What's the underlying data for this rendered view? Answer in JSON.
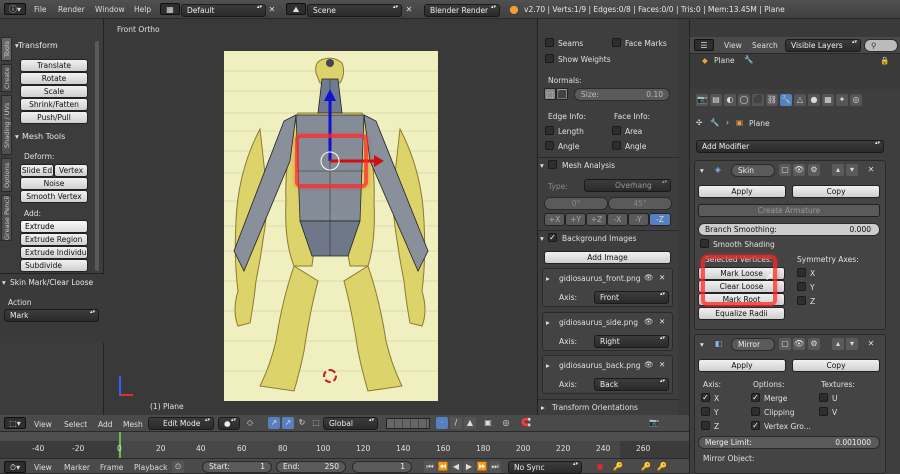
{
  "info_bar": {
    "menus": [
      "File",
      "Render",
      "Window",
      "Help"
    ],
    "layout": "Default",
    "scene": "Scene",
    "engine": "Blender Render",
    "stats": "v2.70 | Verts:1/9 | Edges:0/8 | Faces:0/0 | Tris:0 | Mem:13.45M | Plane"
  },
  "tool_tabs": [
    "Tools",
    "Create",
    "Shading / UVs",
    "Options",
    "Grease Pencil"
  ],
  "tool_shelf": {
    "transform_header": "Transform",
    "transform_buttons": [
      "Translate",
      "Rotate",
      "Scale",
      "Shrink/Fatten",
      "Push/Pull"
    ],
    "mesh_tools_header": "Mesh Tools",
    "deform_label": "Deform:",
    "slide_edge": "Slide Ed",
    "vertex": "Vertex",
    "noise": "Noise",
    "smooth_vertex": "Smooth Vertex",
    "add_label": "Add:",
    "extrude": "Extrude",
    "extrude_region": "Extrude Region",
    "extrude_individual": "Extrude Individual",
    "subdivide": "Subdivide",
    "operator_header": "Skin Mark/Clear Loose",
    "action_label": "Action",
    "action_value": "Mark"
  },
  "viewport": {
    "view_name": "Front Ortho",
    "object_label": "(1) Plane"
  },
  "properties_panel": {
    "seams": "Seams",
    "face_marks": "Face Marks",
    "show_weights": "Show Weights",
    "normals_label": "Normals:",
    "size_field": "Size:",
    "size_value": "0.10",
    "edge_info": "Edge Info:",
    "face_info": "Face Info:",
    "length": "Length",
    "area": "Area",
    "angle1": "Angle",
    "angle2": "Angle",
    "mesh_analysis": "Mesh Analysis",
    "type_label": "Type:",
    "type_value": "Overhang",
    "range_min": "0°",
    "range_max": "45°",
    "axes": [
      "+X",
      "+Y",
      "+Z",
      "-X",
      "-Y",
      "-Z"
    ],
    "background_images": "Background Images",
    "add_image": "Add Image",
    "images": [
      {
        "name": "gidiosaurus_front.png",
        "axis_label": "Axis:",
        "axis": "Front"
      },
      {
        "name": "gidiosaurus_side.png",
        "axis_label": "Axis:",
        "axis": "Right"
      },
      {
        "name": "gidiosaurus_back.png",
        "axis_label": "Axis:",
        "axis": "Back"
      }
    ],
    "transform_orientations": "Transform Orientations"
  },
  "outliner": {
    "menus": [
      "View",
      "Search"
    ],
    "display": "Visible Layers",
    "item": "Plane"
  },
  "modifiers": {
    "breadcrumb": "Plane",
    "add_modifier": "Add Modifier",
    "skin": {
      "name": "Skin",
      "apply": "Apply",
      "copy": "Copy",
      "create_armature": "Create Armature",
      "branch_smoothing_label": "Branch Smoothing:",
      "branch_smoothing_value": "0.000",
      "smooth_shading": "Smooth Shading",
      "selected_vertices": "Selected Vertices:",
      "symmetry_axes": "Symmetry Axes:",
      "mark_loose": "Mark Loose",
      "clear_loose": "Clear Loose",
      "mark_root": "Mark Root",
      "equalize_radii": "Equalize Radii",
      "sym": [
        "X",
        "Y",
        "Z"
      ]
    },
    "mirror": {
      "name": "Mirror",
      "apply": "Apply",
      "copy": "Copy",
      "axis_label": "Axis:",
      "options_label": "Options:",
      "textures_label": "Textures:",
      "axes": [
        "X",
        "Y",
        "Z"
      ],
      "merge": "Merge",
      "clipping": "Clipping",
      "vertex_groups": "Vertex Gro...",
      "tex": [
        "U",
        "V"
      ],
      "merge_limit_label": "Merge Limit:",
      "merge_limit_value": "0.001000",
      "mirror_object": "Mirror Object:"
    }
  },
  "view3d_header": {
    "menus": [
      "View",
      "Select",
      "Add",
      "Mesh"
    ],
    "mode": "Edit Mode",
    "orientation": "Global"
  },
  "timeline": {
    "ticks": [
      "-40",
      "-20",
      "0",
      "20",
      "40",
      "60",
      "80",
      "100",
      "120",
      "140",
      "160",
      "180",
      "200",
      "220",
      "240",
      "260"
    ],
    "menus": [
      "View",
      "Marker",
      "Frame",
      "Playback"
    ],
    "start_label": "Start:",
    "start_value": "1",
    "end_label": "End:",
    "end_value": "250",
    "current": "1",
    "sync": "No Sync"
  }
}
